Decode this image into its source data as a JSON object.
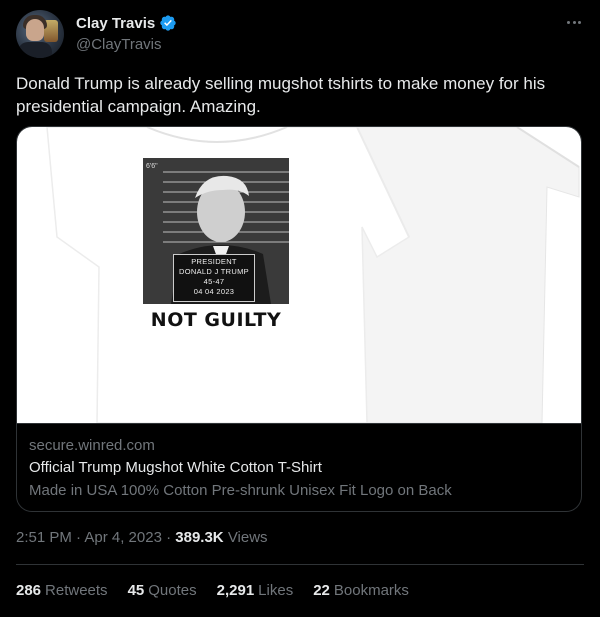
{
  "author": {
    "display_name": "Clay Travis",
    "handle": "@ClayTravis",
    "verified_icon": "verified-badge-icon",
    "verified_color": "#1d9bf0"
  },
  "tweet": {
    "text": "Donald Trump is already selling mugshot tshirts to make money for his presidential campaign. Amazing."
  },
  "card": {
    "mugshot": {
      "height_mark": "6'6\"",
      "board_lines": [
        "PRESIDENT",
        "DONALD J TRUMP",
        "45-47",
        "04 04 2023"
      ]
    },
    "shirt_print_text": "NOT GUILTY",
    "domain": "secure.winred.com",
    "title": "Official Trump Mugshot White Cotton T-Shirt",
    "description": "Made in USA 100% Cotton Pre-shrunk Unisex Fit Logo on Back"
  },
  "meta": {
    "timestamp": "2:51 PM · Apr 4, 2023",
    "separator": " · ",
    "views_count": "389.3K",
    "views_label": "Views"
  },
  "stats": [
    {
      "num": "286",
      "label": "Retweets"
    },
    {
      "num": "45",
      "label": "Quotes"
    },
    {
      "num": "2,291",
      "label": "Likes"
    },
    {
      "num": "22",
      "label": "Bookmarks"
    }
  ],
  "colors": {
    "background": "#000000",
    "text_primary": "#e7e9ea",
    "text_secondary": "#71767b",
    "border": "#2f3336",
    "accent": "#1d9bf0"
  }
}
